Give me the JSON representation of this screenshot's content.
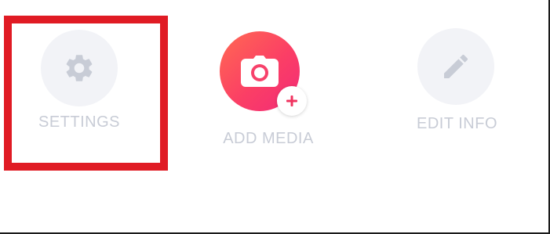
{
  "actions": {
    "settings": {
      "label": "SETTINGS",
      "icon": "gear-icon"
    },
    "add_media": {
      "label": "ADD MEDIA",
      "icon": "camera-icon",
      "badge_icon": "plus-icon"
    },
    "edit_info": {
      "label": "EDIT INFO",
      "icon": "pencil-icon"
    }
  },
  "colors": {
    "highlight": "#e01b24",
    "icon_grey": "#c8ccd6",
    "label_grey": "#c8ccd6",
    "circle_grey": "#f2f3f7",
    "media_gradient_start": "#ff6a52",
    "media_gradient_end": "#f22a78",
    "badge_plus": "#f0335f"
  }
}
